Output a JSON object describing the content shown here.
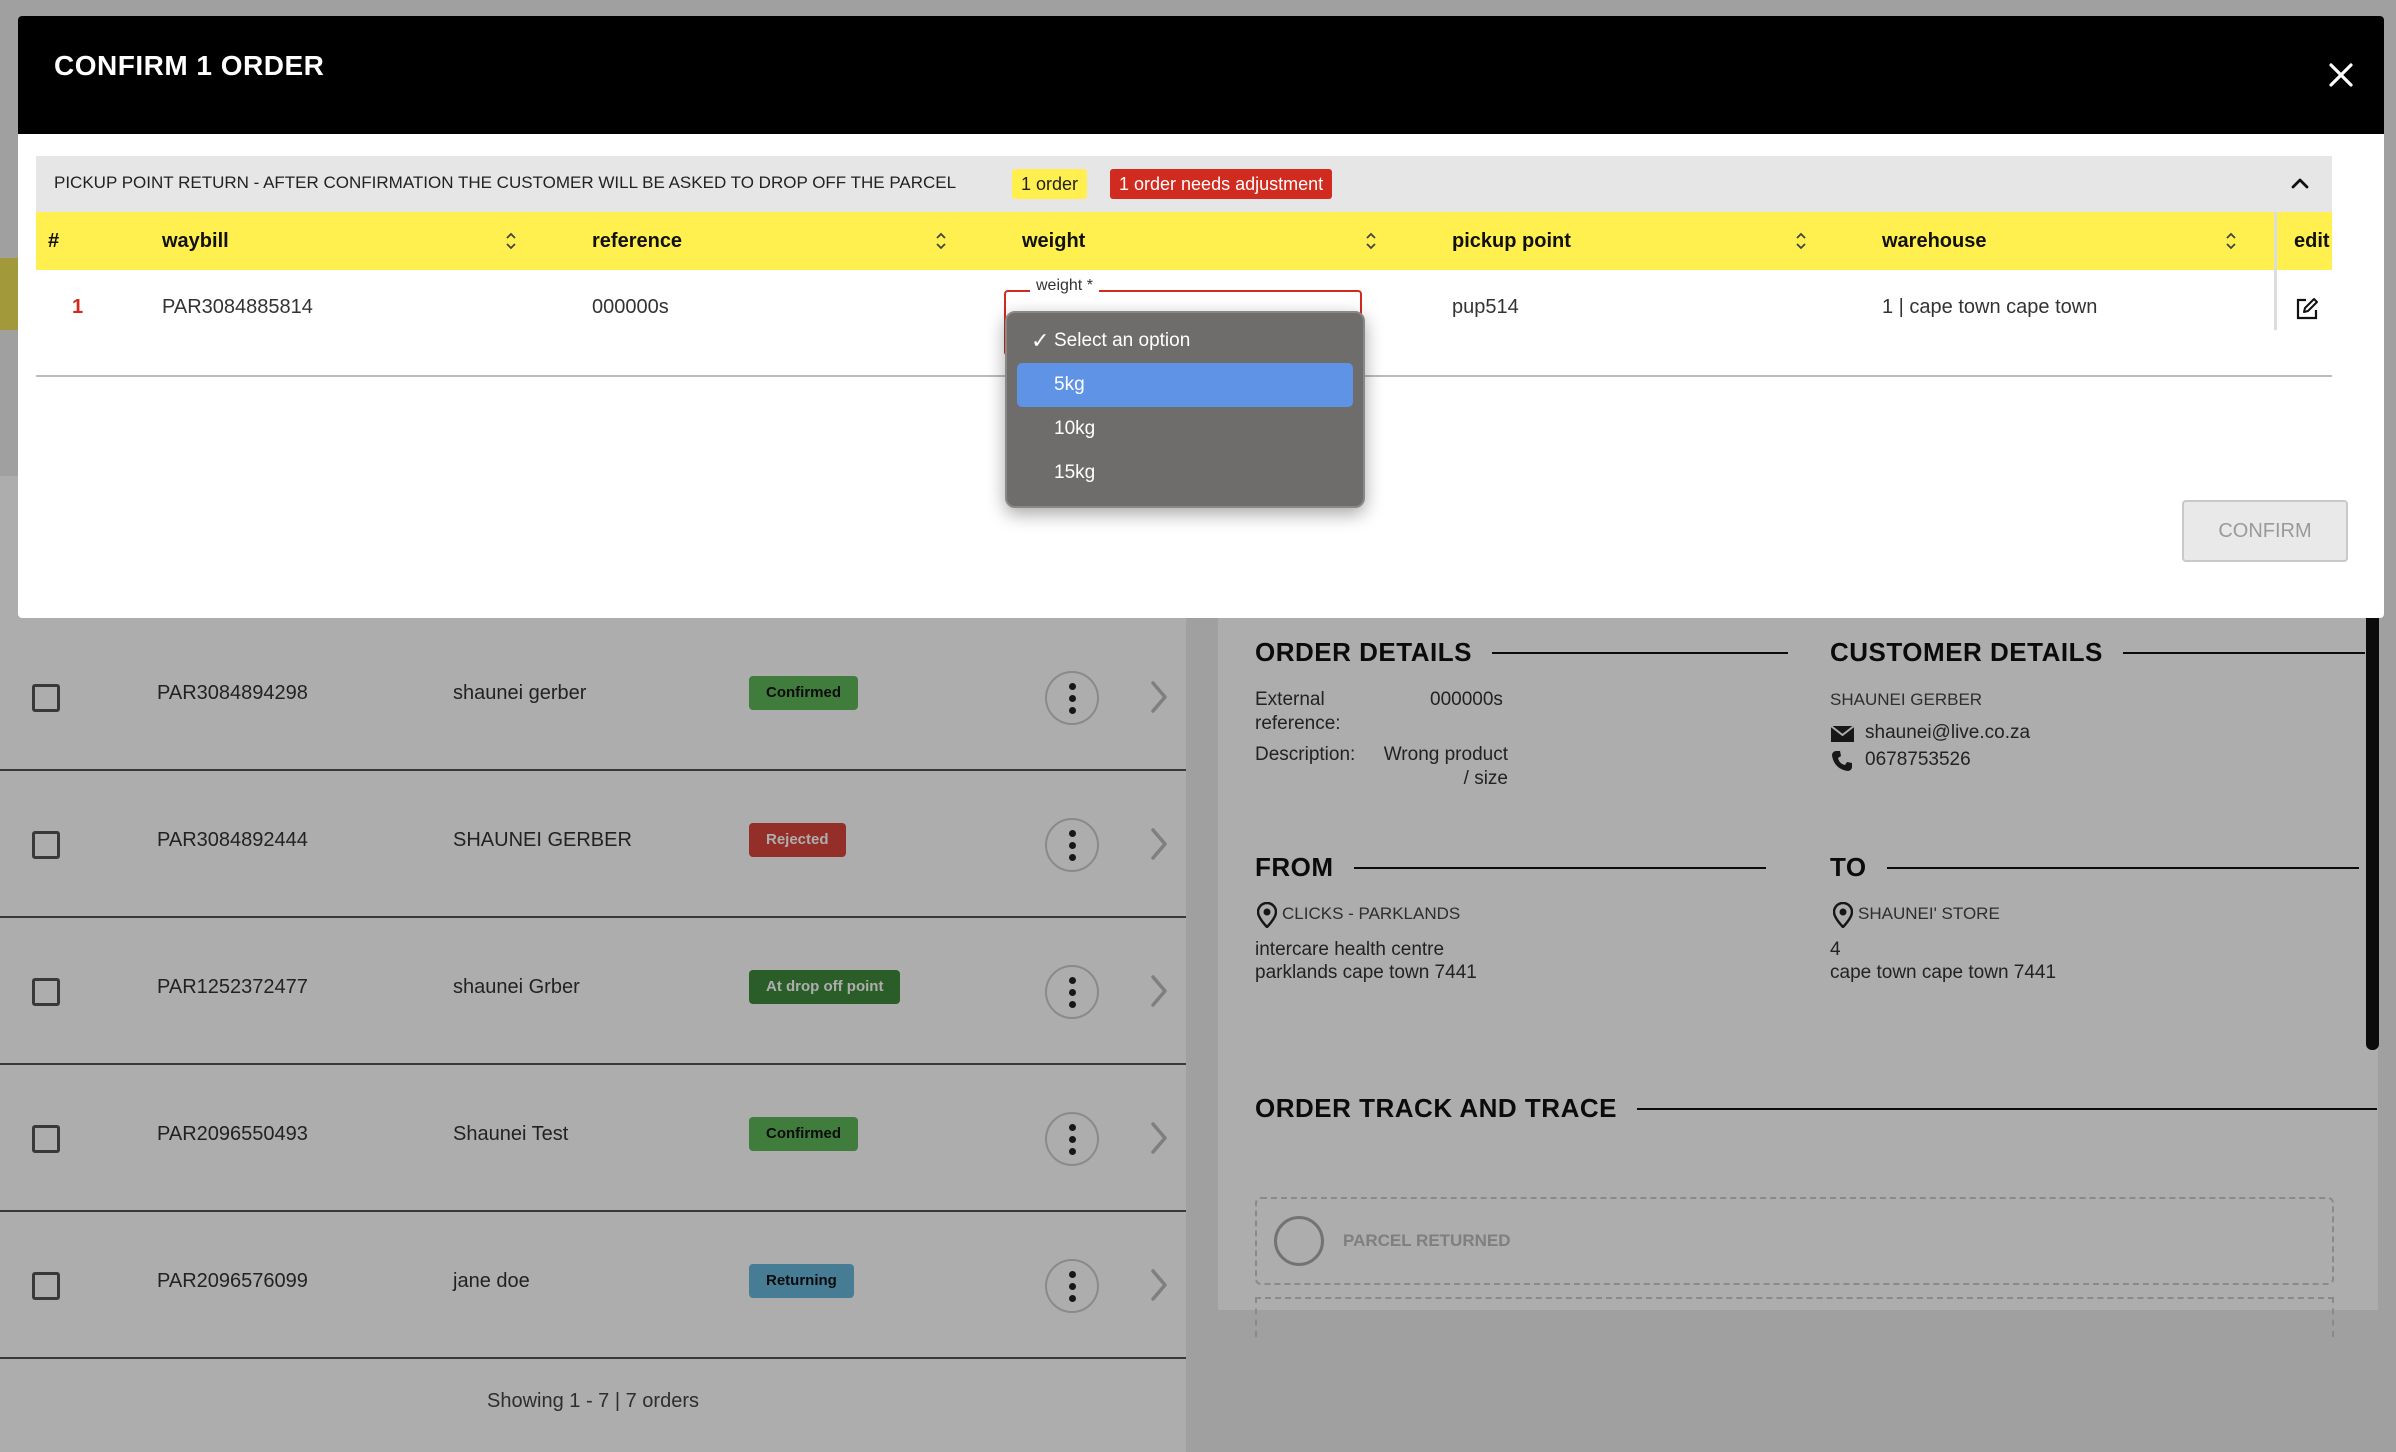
{
  "modal": {
    "title": "CONFIRM 1 ORDER",
    "group": {
      "title": "Pickup point return - after confirmation the customer will be asked to drop off the parcel",
      "order_count": "1 order",
      "adjust_badge": "1 order needs adjustment"
    },
    "table": {
      "headers": {
        "num": "#",
        "waybill": "waybill",
        "reference": "reference",
        "weight": "weight",
        "pickup_point": "pickup point",
        "warehouse": "warehouse",
        "edit": "edit"
      },
      "row": {
        "num": "1",
        "waybill": "PAR3084885814",
        "reference": "000000s",
        "weight_label": "weight *",
        "pickup_point": "pup514",
        "warehouse": "1 | cape town cape town"
      }
    },
    "weight_options": [
      "Select an option",
      "5kg",
      "10kg",
      "15kg"
    ],
    "weight_selected": "Select an option",
    "weight_highlighted": "5kg",
    "confirm_label": "CONFIRM"
  },
  "orders": [
    {
      "waybill": "PAR3084894298",
      "name": "shaunei gerber",
      "status": "Confirmed"
    },
    {
      "waybill": "PAR3084892444",
      "name": "SHAUNEI GERBER",
      "status": "Rejected"
    },
    {
      "waybill": "PAR1252372477",
      "name": "shaunei Grber",
      "status": "At drop off point"
    },
    {
      "waybill": "PAR2096550493",
      "name": "Shaunei Test",
      "status": "Confirmed"
    },
    {
      "waybill": "PAR2096576099",
      "name": "jane doe",
      "status": "Returning"
    }
  ],
  "status_colors": {
    "Confirmed": "#5fb85a",
    "Rejected": "#d9443c",
    "At drop off point": "#3f8a3a",
    "Returning": "#67b9dc"
  },
  "footer": "Showing 1 - 7 | 7 orders",
  "details": {
    "order_details_title": "ORDER DETAILS",
    "external_reference_label": "External reference:",
    "external_reference_value": "000000s",
    "description_label": "Description:",
    "description_value": "Wrong product / size",
    "customer_details_title": "CUSTOMER DETAILS",
    "customer_name": "SHAUNEI GERBER",
    "customer_email": "shaunei@live.co.za",
    "customer_phone": "0678753526",
    "from_title": "FROM",
    "from_store": "CLICKS - PARKLANDS",
    "from_address_1": "intercare health centre",
    "from_address_2": "parklands cape town 7441",
    "to_title": "TO",
    "to_store": "SHAUNEI' STORE",
    "to_address_1": "4",
    "to_address_2": "cape town cape town 7441",
    "track_title": "ORDER TRACK AND TRACE",
    "track_first_step": "PARCEL RETURNED"
  }
}
